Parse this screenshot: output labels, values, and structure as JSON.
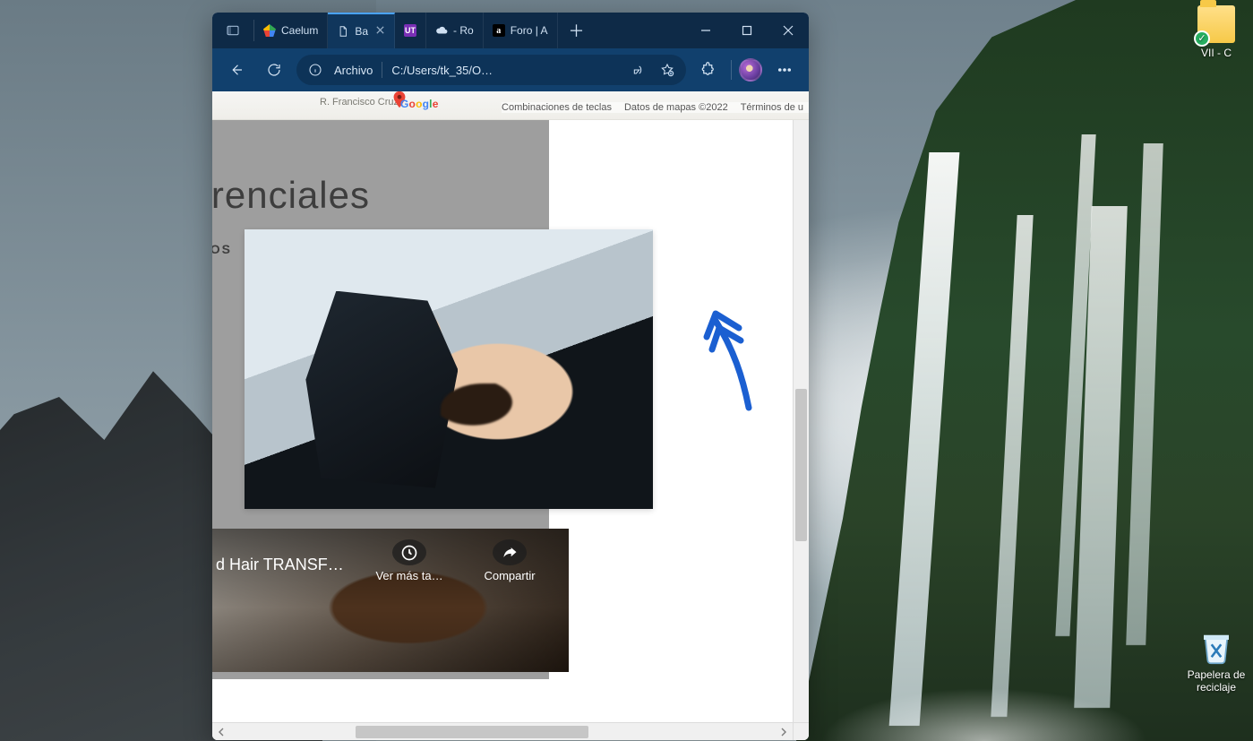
{
  "desktop_icons": {
    "folder": {
      "label": "VII - C"
    },
    "recycle_bin": {
      "label": "Papelera de reciclaje"
    }
  },
  "browser": {
    "tabs": [
      {
        "label": "Caelum",
        "active": false,
        "favicon": "maps-pin-icon"
      },
      {
        "label": "Ba",
        "active": true,
        "favicon": "file-icon"
      },
      {
        "label": "",
        "active": false,
        "favicon": "ut-icon"
      },
      {
        "label": "- Ro",
        "active": false,
        "favicon": "cloud-icon"
      },
      {
        "label": "Foro | A",
        "active": false,
        "favicon": "letter-a-icon"
      }
    ],
    "address": {
      "scheme_label": "Archivo",
      "url": "C:/Users/tk_35/O…"
    }
  },
  "map": {
    "street_label": "R. Francisco Cruz",
    "google": [
      "G",
      "o",
      "o",
      "g",
      "l",
      "e"
    ],
    "links": {
      "shortcuts": "Combinaciones de teclas",
      "mapdata": "Datos de mapas ©2022",
      "terms": "Términos de u"
    }
  },
  "page": {
    "heading": "erenciales",
    "subline": "LOS"
  },
  "video": {
    "title": "d Hair TRANSF…",
    "watch_later": "Ver más ta…",
    "share": "Compartir"
  }
}
